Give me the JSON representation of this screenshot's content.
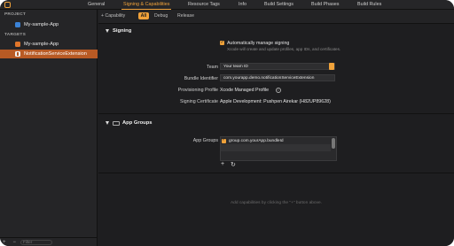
{
  "tabs": [
    "General",
    "Signing & Capabilities",
    "Resource Tags",
    "Info",
    "Build Settings",
    "Build Phases",
    "Build Rules"
  ],
  "sidebar": {
    "project_header": "PROJECT",
    "project_item": "My-sample-App",
    "targets_header": "TARGETS",
    "targets": [
      "My-sample-App",
      "NotificationServiceExtension"
    ],
    "filter_placeholder": "Filter"
  },
  "toolbar": {
    "capability_label": "+ Capability",
    "filters": [
      "All",
      "Debug",
      "Release"
    ]
  },
  "signing": {
    "section_title": "Signing",
    "auto_manage_label": "Automatically manage signing",
    "auto_manage_help": "Xcode will create and update profiles, app IDs, and certificates.",
    "team_label": "Team",
    "team_value": "Your team ID",
    "bundle_label": "Bundle Identifier",
    "bundle_value": "com.yourapp.demo.notificationServiceExtension",
    "profile_label": "Provisioning Profile",
    "profile_value": "Xcode Managed Profile",
    "cert_label": "Signing Certificate",
    "cert_value": "Apple Development: Pushpen Airekar (H82UP89628)"
  },
  "app_groups": {
    "section_title": "App Groups",
    "label": "App Groups",
    "items": [
      "group.com.yourApp.bundleId"
    ]
  },
  "empty_note": "Add capabilities by clicking the \"+\" button above.",
  "colors": {
    "accent": "#f0a23a",
    "selection": "#b85a24",
    "background": "#1e1e20"
  }
}
